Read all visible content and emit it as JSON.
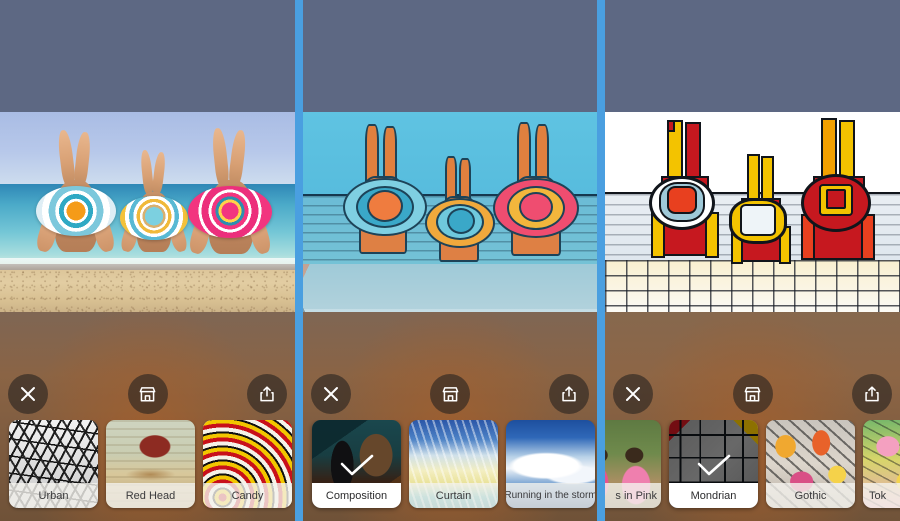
{
  "app": {
    "kind": "photo-style-transfer-app",
    "accent_divider_color": "#4a9fe0",
    "statusbar_color": "#5d6883"
  },
  "panels": [
    {
      "id": "panel-original",
      "image_alt": "Three women lying on the beach with colorful sun hats, feet in the air",
      "actions": {
        "close_label": "Close",
        "store_label": "Store",
        "share_label": "Share"
      },
      "styles": [
        {
          "label": "Urban",
          "thumb": "t-urban",
          "selected": false
        },
        {
          "label": "Red Head",
          "thumb": "t-redhead",
          "selected": false
        },
        {
          "label": "Candy",
          "thumb": "t-candy",
          "selected": false
        }
      ]
    },
    {
      "id": "panel-composition",
      "image_alt": "Beach photo rendered in a bold cubist Composition style",
      "actions": {
        "close_label": "Close",
        "store_label": "Store",
        "share_label": "Share"
      },
      "styles": [
        {
          "label": "Composition",
          "thumb": "t-composition",
          "selected": true
        },
        {
          "label": "Curtain",
          "thumb": "t-curtain",
          "selected": false
        },
        {
          "label": "Running in the storm",
          "thumb": "t-storm",
          "selected": false
        }
      ]
    },
    {
      "id": "panel-mondrian",
      "image_alt": "Beach photo rendered in a Mondrian primary-color grid style",
      "actions": {
        "close_label": "Close",
        "store_label": "Store",
        "share_label": "Share"
      },
      "styles": [
        {
          "label": "s in Pink",
          "thumb": "t-pink",
          "selected": false
        },
        {
          "label": "Mondrian",
          "thumb": "t-mondrian",
          "selected": true
        },
        {
          "label": "Gothic",
          "thumb": "t-gothic",
          "selected": false
        },
        {
          "label": "Tok",
          "thumb": "t-tokyo",
          "selected": false
        }
      ]
    }
  ],
  "icons": {
    "close": "close-icon",
    "store": "store-icon",
    "share": "share-icon",
    "check": "checkmark-icon"
  }
}
